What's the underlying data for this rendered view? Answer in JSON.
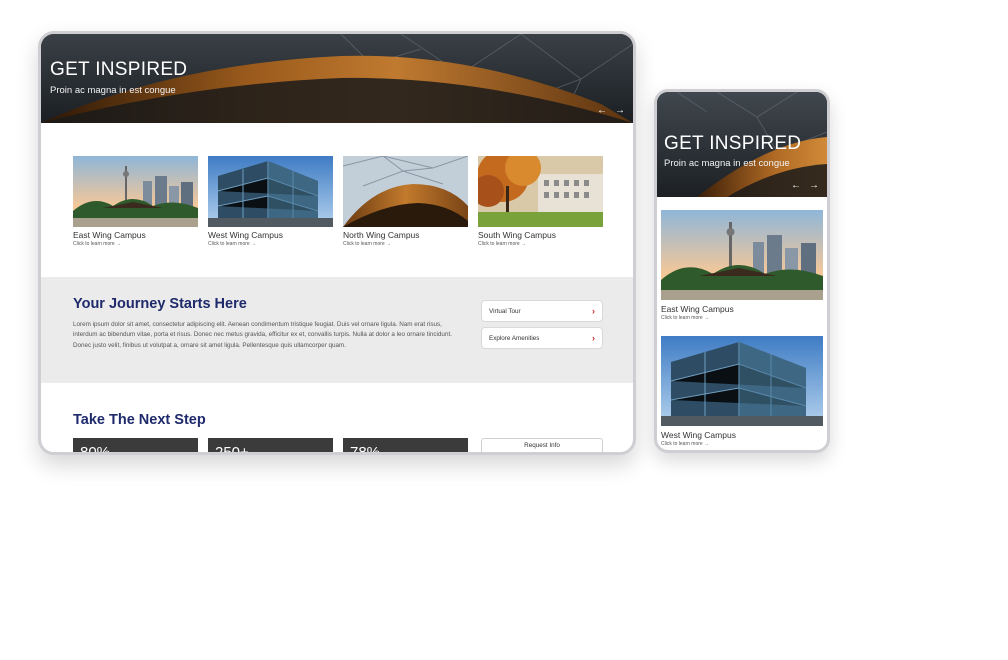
{
  "hero": {
    "title": "GET INSPIRED",
    "subtitle": "Proin ac magna in est congue",
    "prev_arrow": "←",
    "next_arrow": "→"
  },
  "campuses": [
    {
      "name": "East Wing Campus",
      "link": "Click to learn more →"
    },
    {
      "name": "West Wing Campus",
      "link": "Click to learn more →"
    },
    {
      "name": "North Wing Campus",
      "link": "Click to learn more →"
    },
    {
      "name": "South Wing Campus",
      "link": "Click to learn more →"
    }
  ],
  "journey": {
    "title": "Your Journey Starts Here",
    "body": "Lorem ipsum dolor sit amet, consectetur adipiscing elit. Aenean condimentum tristique feugiat. Duis vel ornare ligula. Nam erat risus, interdum ac bibendum vitae, porta et risus. Donec nec metus gravida, efficitur ex et, convallis turpis. Nulla at dolor a leo ornare tincidunt. Donec justo velit, finibus ut volutpat a, ornare sit amet ligula. Pellentesque quis ullamcorper quam.",
    "buttons": [
      {
        "label": "Virtual Tour",
        "chevron": "›"
      },
      {
        "label": "Explore Amenities",
        "chevron": "›"
      }
    ]
  },
  "next_step": {
    "title": "Take The Next Step",
    "stats": [
      "80%",
      "250+",
      "78%"
    ],
    "request_label": "Request Info"
  },
  "colors": {
    "heading": "#1e2a6c",
    "chevron": "#d02b2b",
    "journey_bg": "#ebebeb",
    "stat_bg": "#3b3b3b"
  },
  "icons": [
    "chevron-right-icon",
    "arrow-left-icon",
    "arrow-right-icon"
  ]
}
